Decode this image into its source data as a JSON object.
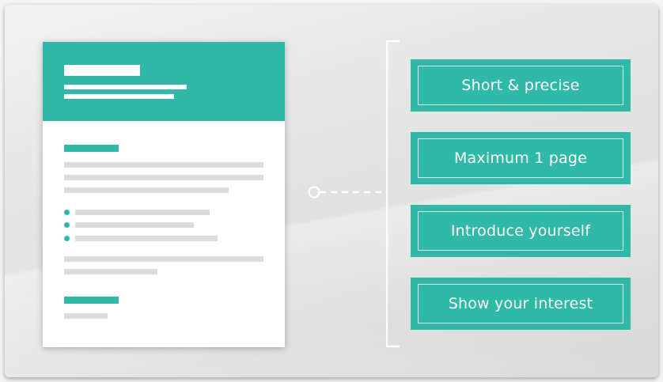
{
  "tags": [
    {
      "label": "Short & precise"
    },
    {
      "label": "Maximum 1 page"
    },
    {
      "label": "Introduce yourself"
    },
    {
      "label": "Show your interest"
    }
  ],
  "colors": {
    "accent": "#2fbaa8",
    "placeholder_line": "#dcdcdc",
    "background": "#e4e4e4"
  },
  "icons": {
    "connector": "circle-dashed-line-connector",
    "bracket": "bracket-line"
  }
}
